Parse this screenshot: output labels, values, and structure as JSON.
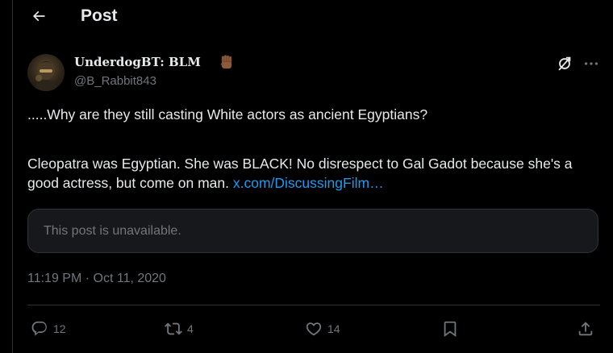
{
  "header": {
    "title": "Post",
    "back_icon": "arrow-left-icon"
  },
  "post": {
    "author": {
      "display_name": "UnderdogBT: BLM",
      "emoji": "raised-fist-icon",
      "handle": "@B_Rabbit843"
    },
    "text_line1": ".....Why are they still casting White actors as ancient Egyptians?",
    "text_line2": "Cleopatra was Egyptian. She was BLACK! No disrespect to Gal Gadot because she's a good actress, but come on man.",
    "link": "x.com/DiscussingFilm…",
    "quoted_status": "This post is unavailable.",
    "timestamp": "11:19 PM · Oct 11, 2020"
  },
  "actions": {
    "replies": "12",
    "reposts": "4",
    "likes": "14"
  },
  "colors": {
    "background": "#000000",
    "text": "#e7e9ea",
    "muted": "#71767b",
    "link": "#1d9bf0",
    "border": "#2f3336"
  }
}
